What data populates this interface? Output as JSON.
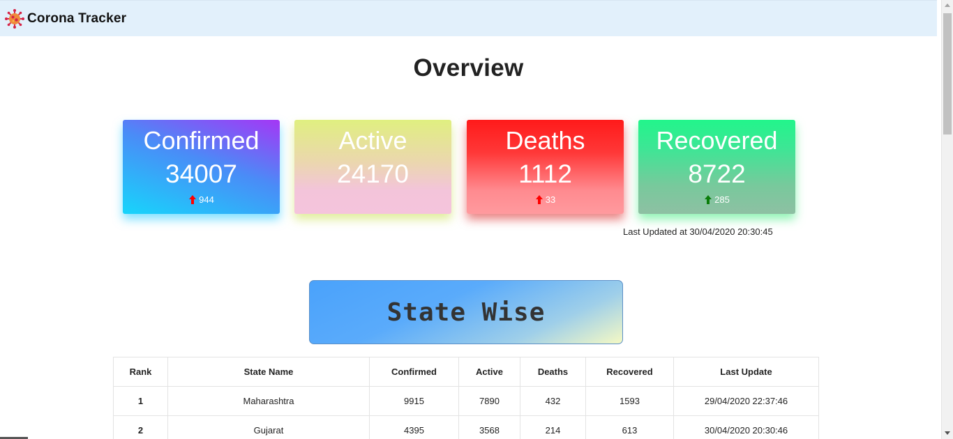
{
  "nav": {
    "brand_title": "Corona Tracker",
    "brand_icon": "virus-icon"
  },
  "overview": {
    "title": "Overview",
    "cards": [
      {
        "label": "Confirmed",
        "value": "34007",
        "delta": "944",
        "delta_color": "#ff0000"
      },
      {
        "label": "Active",
        "value": "24170",
        "delta": "",
        "delta_color": ""
      },
      {
        "label": "Deaths",
        "value": "1112",
        "delta": "33",
        "delta_color": "#ff0000"
      },
      {
        "label": "Recovered",
        "value": "8722",
        "delta": "285",
        "delta_color": "#0a7d0a"
      }
    ],
    "last_updated": "Last Updated at 30/04/2020 20:30:45"
  },
  "state_section": {
    "title": "State Wise"
  },
  "table": {
    "headers": [
      "Rank",
      "State Name",
      "Confirmed",
      "Active",
      "Deaths",
      "Recovered",
      "Last Update"
    ],
    "rows": [
      [
        "1",
        "Maharashtra",
        "9915",
        "7890",
        "432",
        "1593",
        "29/04/2020 22:37:46"
      ],
      [
        "2",
        "Gujarat",
        "4395",
        "3568",
        "214",
        "613",
        "30/04/2020 20:30:46"
      ]
    ]
  },
  "colors": {
    "navbar_bg": "#e2f0fb",
    "increase_red": "#ff0000",
    "increase_green": "#0a7d0a"
  }
}
